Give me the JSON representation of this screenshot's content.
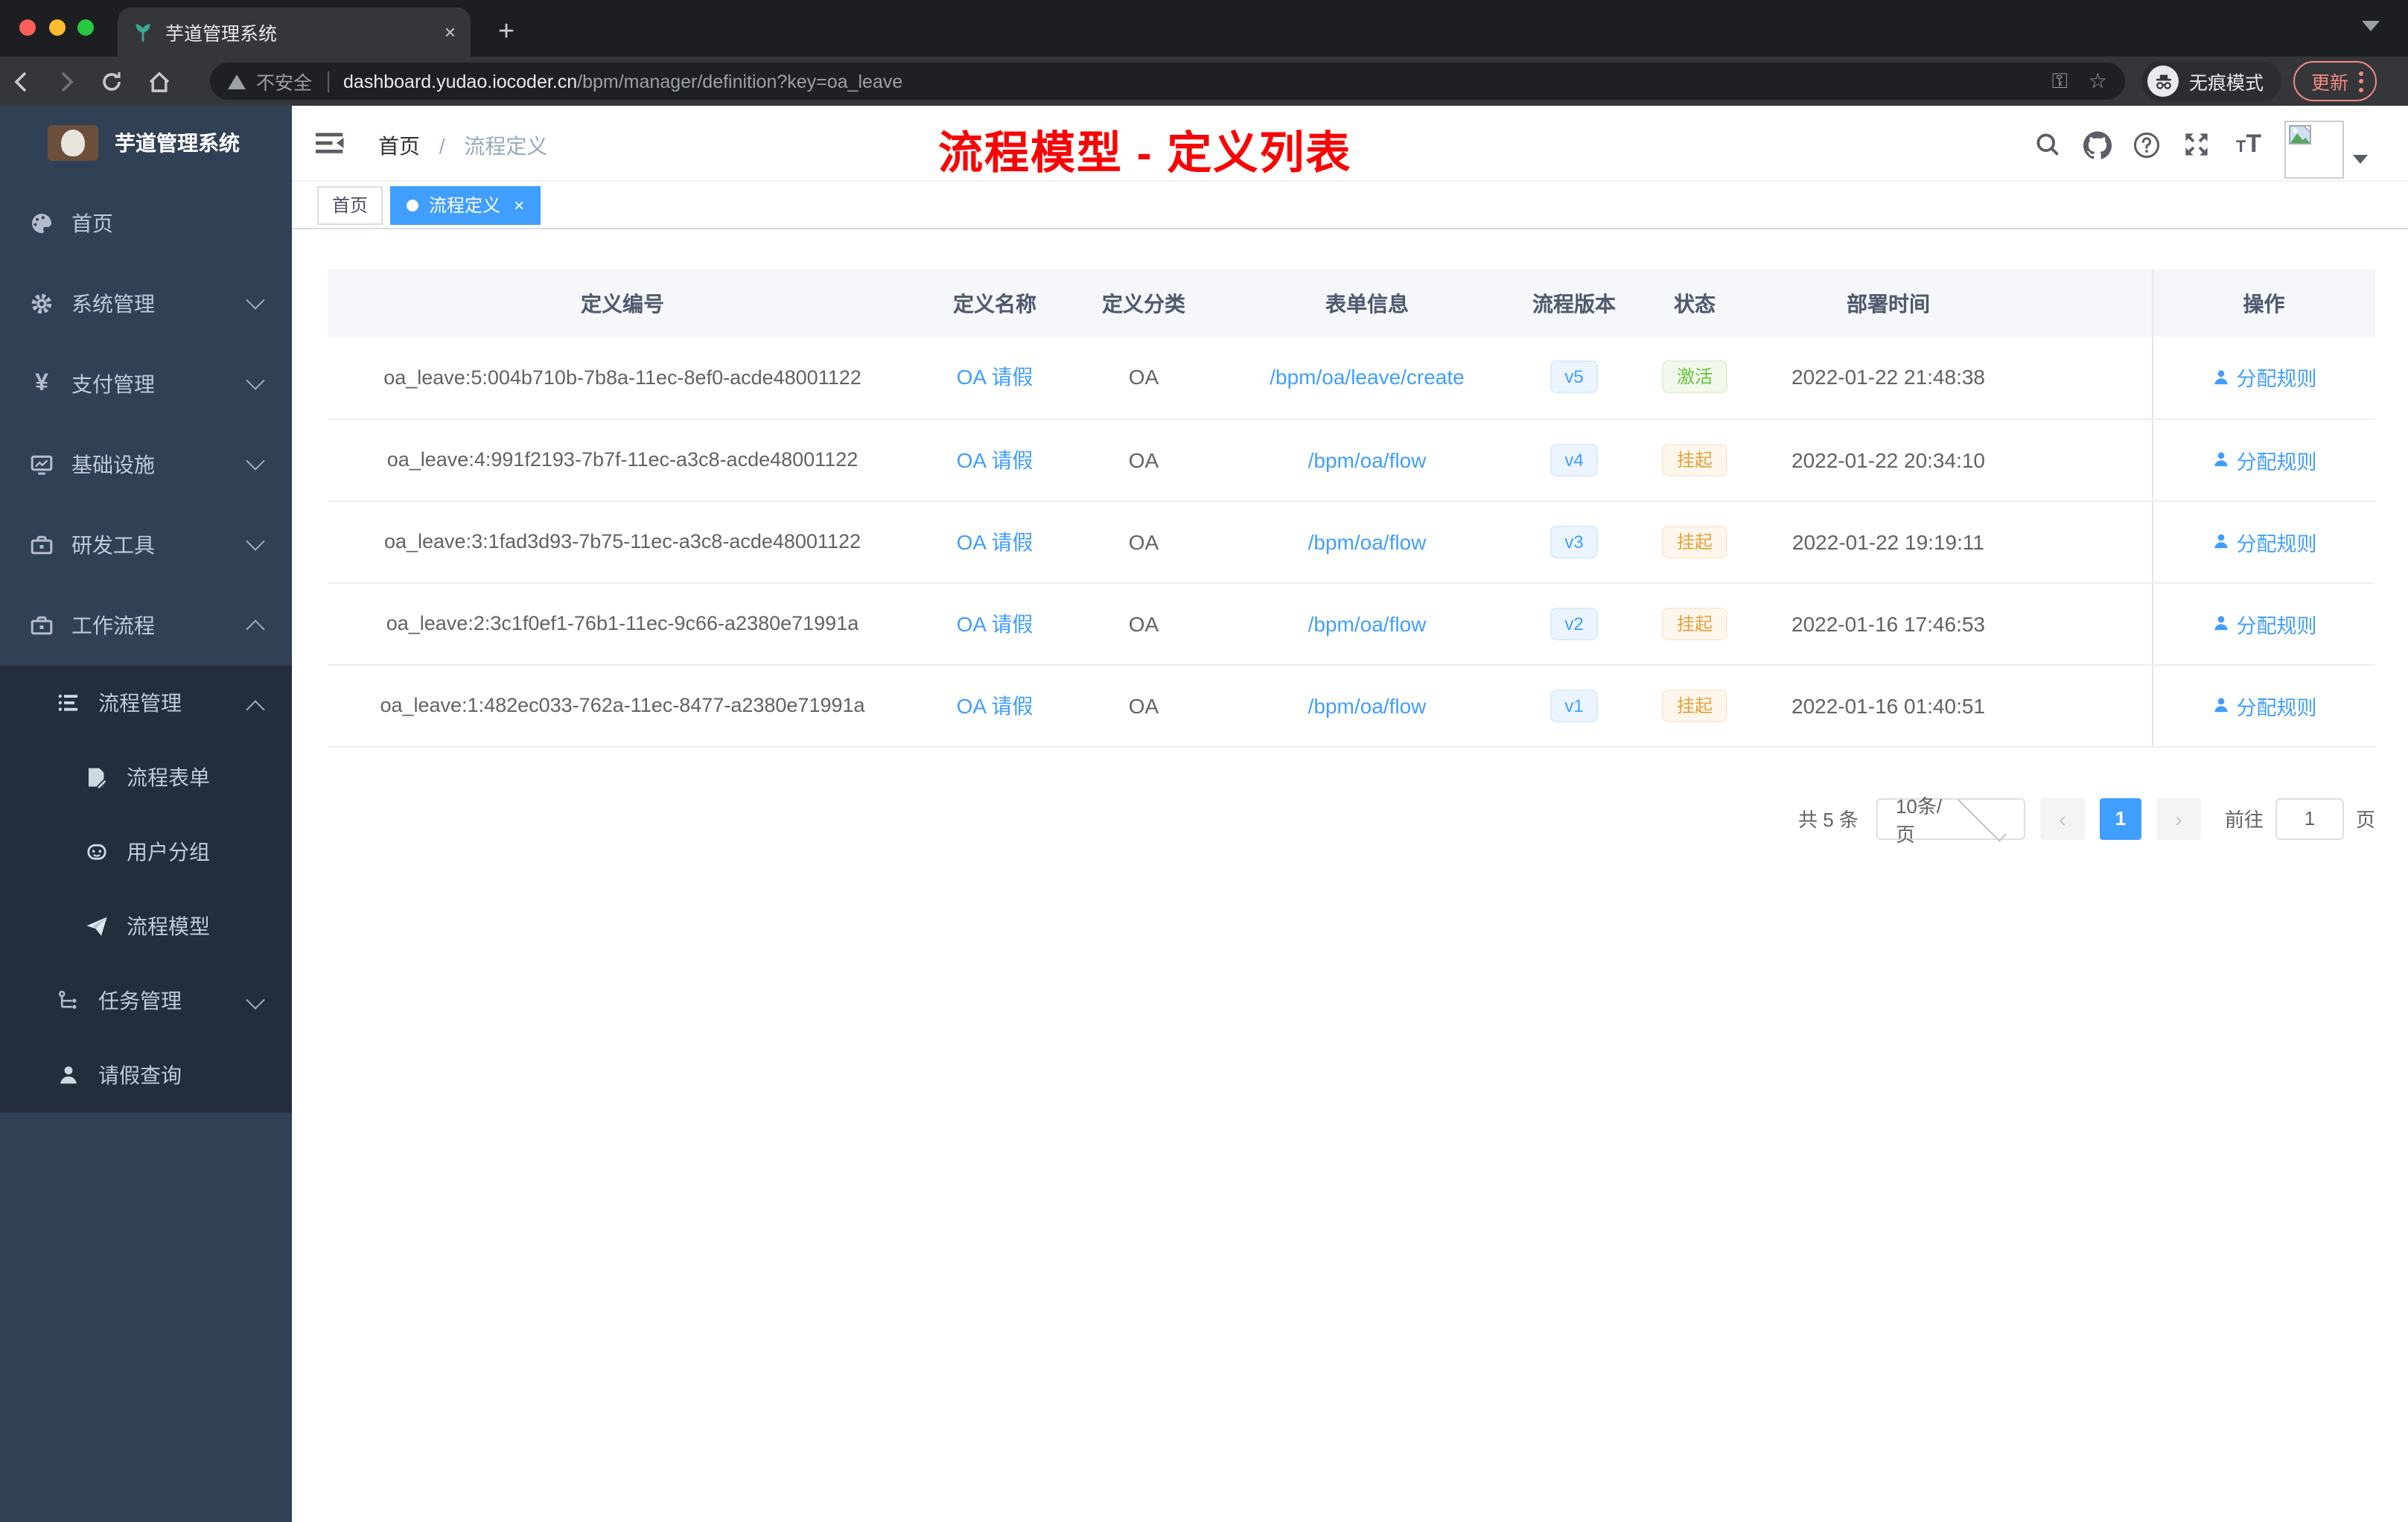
{
  "browser": {
    "tab_title": "芋道管理系统",
    "new_tab": "+",
    "close_tab": "×",
    "security_label": "不安全",
    "url_host": "dashboard.yudao.iocoder.cn",
    "url_path": "/bpm/manager/definition?key=oa_leave",
    "incognito_label": "无痕模式",
    "update_label": "更新"
  },
  "sidebar": {
    "logo_title": "芋道管理系统",
    "items": [
      {
        "label": "首页"
      },
      {
        "label": "系统管理"
      },
      {
        "label": "支付管理"
      },
      {
        "label": "基础设施"
      },
      {
        "label": "研发工具"
      },
      {
        "label": "工作流程"
      },
      {
        "label": "流程管理"
      },
      {
        "label": "流程表单"
      },
      {
        "label": "用户分组"
      },
      {
        "label": "流程模型"
      },
      {
        "label": "任务管理"
      },
      {
        "label": "请假查询"
      }
    ]
  },
  "navbar": {
    "breadcrumb_home": "首页",
    "breadcrumb_separator": "/",
    "breadcrumb_current": "流程定义"
  },
  "tags": {
    "home": "首页",
    "active": "流程定义",
    "close": "×"
  },
  "annotation": "流程模型 - 定义列表",
  "table": {
    "headers": [
      "定义编号",
      "定义名称",
      "定义分类",
      "表单信息",
      "流程版本",
      "状态",
      "部署时间",
      "操作"
    ],
    "action_label": "分配规则",
    "rows": [
      {
        "id": "oa_leave:5:004b710b-7b8a-11ec-8ef0-acde48001122",
        "name": "OA 请假",
        "category": "OA",
        "form": "/bpm/oa/leave/create",
        "version": "v5",
        "status": "激活",
        "time": "2022-01-22 21:48:38"
      },
      {
        "id": "oa_leave:4:991f2193-7b7f-11ec-a3c8-acde48001122",
        "name": "OA 请假",
        "category": "OA",
        "form": "/bpm/oa/flow",
        "version": "v4",
        "status": "挂起",
        "time": "2022-01-22 20:34:10"
      },
      {
        "id": "oa_leave:3:1fad3d93-7b75-11ec-a3c8-acde48001122",
        "name": "OA 请假",
        "category": "OA",
        "form": "/bpm/oa/flow",
        "version": "v3",
        "status": "挂起",
        "time": "2022-01-22 19:19:11"
      },
      {
        "id": "oa_leave:2:3c1f0ef1-76b1-11ec-9c66-a2380e71991a",
        "name": "OA 请假",
        "category": "OA",
        "form": "/bpm/oa/flow",
        "version": "v2",
        "status": "挂起",
        "time": "2022-01-16 17:46:53"
      },
      {
        "id": "oa_leave:1:482ec033-762a-11ec-8477-a2380e71991a",
        "name": "OA 请假",
        "category": "OA",
        "form": "/bpm/oa/flow",
        "version": "v1",
        "status": "挂起",
        "time": "2022-01-16 01:40:51"
      }
    ]
  },
  "pagination": {
    "total": "共 5 条",
    "page_size": "10条/页",
    "page": "1",
    "goto": "前往",
    "goto_value": "1",
    "page_unit": "页"
  },
  "colors": {
    "accent": "#409eff",
    "status_active": "#67c23a",
    "status_suspended": "#e6a23c",
    "annotation_red": "#f70505",
    "sidebar_bg": "#304156",
    "submenu_bg": "#232d3c"
  }
}
